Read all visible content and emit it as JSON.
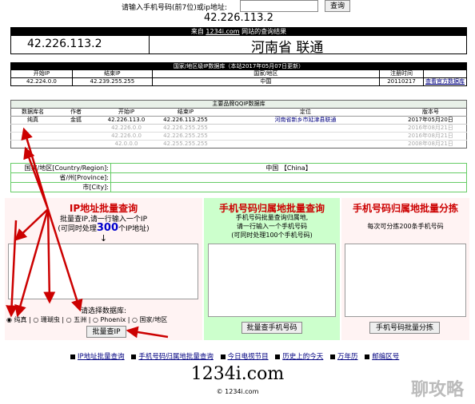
{
  "search": {
    "label": "请输入手机号码(前7位)或ip地址:",
    "value": "",
    "button": "查询",
    "ip_display": "42.226.113.2"
  },
  "result": {
    "from": "来自",
    "site": "1234i.com",
    "suffix": "网站的查询结果",
    "ip": "42.226.113.2",
    "location": "河南省 联通"
  },
  "db_table": {
    "title": "国家/地区级IP数据库（本站2017年05月07日更新）",
    "headers": [
      "开始IP",
      "结束IP",
      "国家/地区",
      "注册时间"
    ],
    "row": [
      "42.224.0.0",
      "42.239.255.255",
      "中国",
      "20110217"
    ],
    "link": "查看官方数据库"
  },
  "brand_table": {
    "title": "主要品牌QQIP数据库",
    "headers": [
      "数据库名",
      "作者",
      "开始IP",
      "结束IP",
      "定位",
      "版本号"
    ],
    "rows": [
      [
        "纯真",
        "金狐",
        "42.226.113.0",
        "42.226.113.255",
        "河南省新乡市延津县联通",
        "2017年05月20日"
      ],
      [
        "",
        "",
        "42.226.0.0",
        "42.226.255.255",
        "",
        "2016年08月21日"
      ],
      [
        "",
        "",
        "42.226.0.0",
        "42.226.255.255",
        "",
        "2016年08月21日"
      ],
      [
        "",
        "",
        "42.0.0.0",
        "42.255.255.255",
        "",
        "2008年08月21日"
      ]
    ]
  },
  "region_table": {
    "labels": [
      "国家/地区[Country/Region]:",
      "省/州[Province]:",
      "市[City]:"
    ],
    "values": [
      "中国 【China】",
      "",
      ""
    ]
  },
  "panel_ip": {
    "title": "IP地址批量查询",
    "line1": "批量查IP,请一行输入一个IP",
    "line2_pre": "(可同时处理",
    "line2_num": "300",
    "line2_post": "个IP地址)",
    "arrow": "↓",
    "choose": "请选择数据库:",
    "options": [
      "纯真",
      "珊瑚虫",
      "五洲",
      "Phoenix",
      "国家/地区"
    ],
    "button": "批量查IP"
  },
  "panel_phone": {
    "title": "手机号码归属地批量查询",
    "line1": "手机号码批量查询归属地,",
    "line2": "请一行输入一个手机号码",
    "line3": "(可同时处理100个手机号码)",
    "button": "批量查手机号码"
  },
  "panel_split": {
    "title": "手机号码归属地批量分拣",
    "line1": "每次可分拣200条手机号码",
    "button": "手机号码批量分拣"
  },
  "footer": {
    "links": [
      "IP地址批量查询",
      "手机号码归属地批量查询",
      "今日电视节目",
      "历史上的今天",
      "万年历",
      "邮编区号"
    ],
    "logo": "1234i.com",
    "copyright": "© 1234i.com"
  },
  "watermark": "聊攻略",
  "colors": {
    "red": "#cc0000",
    "green_panel": "#ccffcc",
    "pink_panel": "#fff0f0",
    "link": "#000080"
  }
}
